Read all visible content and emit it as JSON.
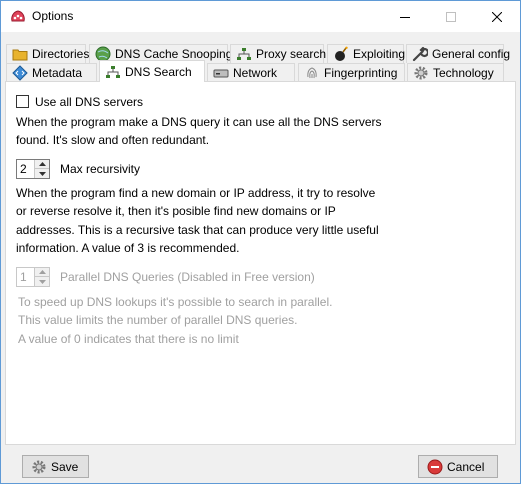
{
  "window": {
    "title": "Options"
  },
  "tabs_row1": [
    {
      "label": "Directories",
      "icon": "folder-icon"
    },
    {
      "label": "DNS Cache Snooping",
      "icon": "globe-icon"
    },
    {
      "label": "Proxy search",
      "icon": "network-icon"
    },
    {
      "label": "Exploiting",
      "icon": "bomb-icon"
    },
    {
      "label": "General config",
      "icon": "wrench-icon"
    }
  ],
  "tabs_row2": [
    {
      "label": "Metadata",
      "icon": "code-icon"
    },
    {
      "label": "DNS Search",
      "icon": "network-icon",
      "active": true
    },
    {
      "label": "Network",
      "icon": "drive-icon"
    },
    {
      "label": "Fingerprinting",
      "icon": "fingerprint-icon"
    },
    {
      "label": "Technology",
      "icon": "gear-icon"
    }
  ],
  "dns_search": {
    "use_all_dns_label": "Use all DNS servers",
    "use_all_dns_checked": false,
    "use_all_dns_desc": [
      "When the program make a DNS query it can use all the DNS servers",
      "found. It's slow and often redundant."
    ],
    "max_recursivity_value": "2",
    "max_recursivity_label": "Max recursivity",
    "max_recursivity_desc": [
      "When the program find a new domain or IP address, it try to resolve",
      "or reverse resolve it, then it's posible find new domains or IP",
      "addresses. This is a recursive task that can produce very little useful",
      "information. A value of 3 is recommended."
    ],
    "parallel_value": "1",
    "parallel_label": "Parallel DNS Queries (Disabled in Free version)",
    "parallel_desc": [
      "To speed up DNS lookups it's possible to search in parallel.",
      "This value limits the number of parallel DNS queries.",
      "A value of 0 indicates that there is no limit"
    ]
  },
  "footer": {
    "save_label": "Save",
    "cancel_label": "Cancel"
  },
  "colors": {
    "window_border": "#5f9ad6",
    "panel_bg": "#ffffff",
    "disabled_text": "#a0a0a0",
    "button_bg": "#e1e1e1"
  }
}
